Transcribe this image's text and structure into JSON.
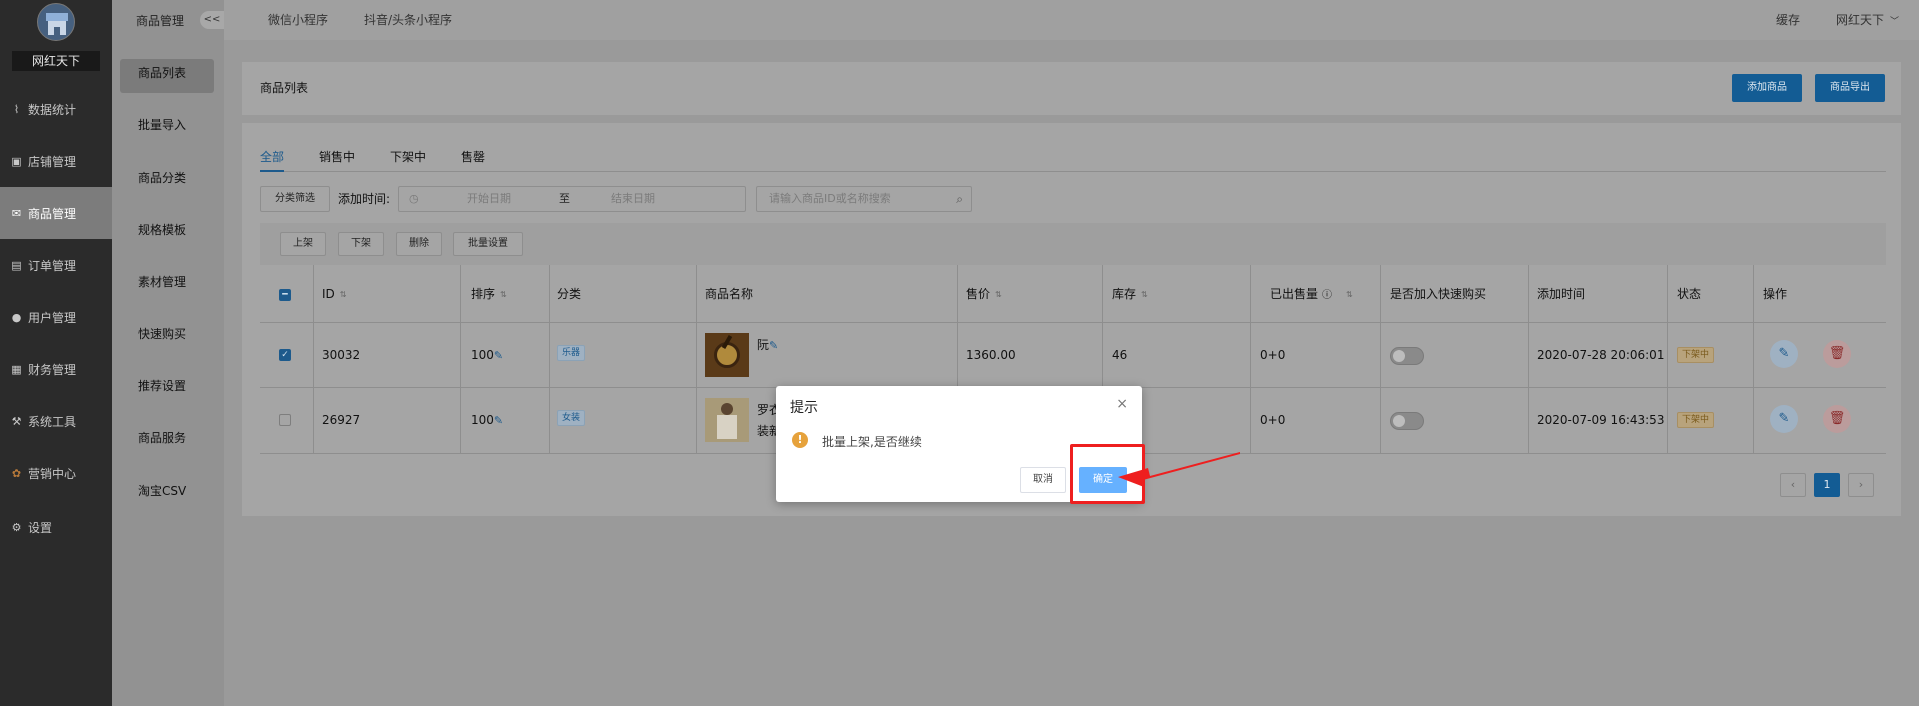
{
  "sidebar": {
    "brand": "网红天下",
    "items": [
      {
        "label": "数据统计",
        "icon": "chart-icon"
      },
      {
        "label": "店铺管理",
        "icon": "store-icon"
      },
      {
        "label": "商品管理",
        "icon": "mail-icon"
      },
      {
        "label": "订单管理",
        "icon": "order-icon"
      },
      {
        "label": "用户管理",
        "icon": "user-icon"
      },
      {
        "label": "财务管理",
        "icon": "finance-icon"
      },
      {
        "label": "系统工具",
        "icon": "wrench-icon"
      },
      {
        "label": "营销中心",
        "icon": "marketing-icon"
      },
      {
        "label": "设置",
        "icon": "gear-icon"
      }
    ]
  },
  "subnav": {
    "title": "商品管理",
    "collapse": "<<",
    "items": [
      "商品列表",
      "批量导入",
      "商品分类",
      "规格模板",
      "素材管理",
      "快速购买",
      "推荐设置",
      "商品服务",
      "淘宝CSV"
    ]
  },
  "topbar": {
    "tabs": [
      "微信小程序",
      "抖音/头条小程序"
    ],
    "cache": "缓存",
    "user": "网红天下"
  },
  "page": {
    "title": "商品列表",
    "add_button": "添加商品",
    "export_button": "商品导出"
  },
  "tabs": [
    "全部",
    "销售中",
    "下架中",
    "售罄"
  ],
  "filters": {
    "category_button": "分类筛选",
    "time_label": "添加时间:",
    "start_placeholder": "开始日期",
    "separator": "至",
    "end_placeholder": "结束日期",
    "search_placeholder": "请输入商品ID或名称搜索"
  },
  "toolbar": [
    "上架",
    "下架",
    "删除",
    "批量设置"
  ],
  "table": {
    "headers": [
      "ID",
      "排序",
      "分类",
      "商品名称",
      "售价",
      "库存",
      "已出售量",
      "是否加入快速购买",
      "添加时间",
      "状态",
      "操作"
    ],
    "rows": [
      {
        "id": "30032",
        "sort": "100",
        "category": "乐器",
        "name": "阮",
        "price": "1360.00",
        "stock": "46",
        "sold": "0+0",
        "time": "2020-07-28 20:06:01",
        "status": "下架中",
        "checked": true
      },
      {
        "id": "26927",
        "sort": "100",
        "category": "女装",
        "name_line1": "罗衣",
        "name_line2": "装新",
        "sold": "0+0",
        "time": "2020-07-09 16:43:53",
        "status": "下架中",
        "checked": false
      }
    ]
  },
  "pager": {
    "prev": "‹",
    "page": "1",
    "next": "›"
  },
  "dialog": {
    "title": "提示",
    "close": "×",
    "icon": "!",
    "message": "批量上架,是否继续",
    "cancel": "取消",
    "confirm": "确定"
  },
  "colors": {
    "primary": "#135c94",
    "highlight": "#ee1f1f",
    "warning": "#e6a23c",
    "confirm": "#66b1ff"
  }
}
